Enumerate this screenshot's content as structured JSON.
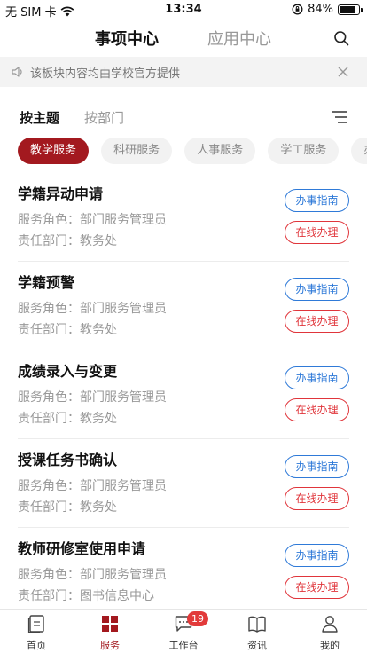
{
  "status_bar": {
    "carrier": "无 SIM 卡",
    "time": "13:34",
    "battery_percent": "84%",
    "battery_level": 0.84
  },
  "top_tabs": [
    {
      "label": "事项中心",
      "active": true
    },
    {
      "label": "应用中心",
      "active": false
    }
  ],
  "notice": {
    "text": "该板块内容均由学校官方提供"
  },
  "group_tabs": [
    {
      "label": "按主题",
      "active": true
    },
    {
      "label": "按部门",
      "active": false
    }
  ],
  "categories": [
    {
      "label": "教学服务",
      "active": true
    },
    {
      "label": "科研服务",
      "active": false
    },
    {
      "label": "人事服务",
      "active": false
    },
    {
      "label": "学工服务",
      "active": false
    },
    {
      "label": "办公",
      "active": false
    }
  ],
  "services": [
    {
      "title": "学籍异动申请",
      "role": "服务角色：部门服务管理员",
      "dept": "责任部门：教务处",
      "guide_label": "办事指南",
      "online_label": "在线办理"
    },
    {
      "title": "学籍预警",
      "role": "服务角色：部门服务管理员",
      "dept": "责任部门：教务处",
      "guide_label": "办事指南",
      "online_label": "在线办理"
    },
    {
      "title": "成绩录入与变更",
      "role": "服务角色：部门服务管理员",
      "dept": "责任部门：教务处",
      "guide_label": "办事指南",
      "online_label": "在线办理"
    },
    {
      "title": "授课任务书确认",
      "role": "服务角色：部门服务管理员",
      "dept": "责任部门：教务处",
      "guide_label": "办事指南",
      "online_label": "在线办理"
    },
    {
      "title": "教师研修室使用申请",
      "role": "服务角色：部门服务管理员",
      "dept": "责任部门：图书信息中心",
      "guide_label": "办事指南",
      "online_label": "在线办理"
    }
  ],
  "tabbar": {
    "items": [
      {
        "label": "首页",
        "icon": "home-icon",
        "active": false
      },
      {
        "label": "服务",
        "icon": "grid-icon",
        "active": true
      },
      {
        "label": "工作台",
        "icon": "chat-icon",
        "active": false,
        "badge": "19"
      },
      {
        "label": "资讯",
        "icon": "book-icon",
        "active": false
      },
      {
        "label": "我的",
        "icon": "person-icon",
        "active": false
      }
    ]
  },
  "colors": {
    "accent": "#a3191f",
    "guide_blue": "#2f7ad8",
    "online_red": "#e0353b",
    "badge_red": "#e23a3a"
  }
}
